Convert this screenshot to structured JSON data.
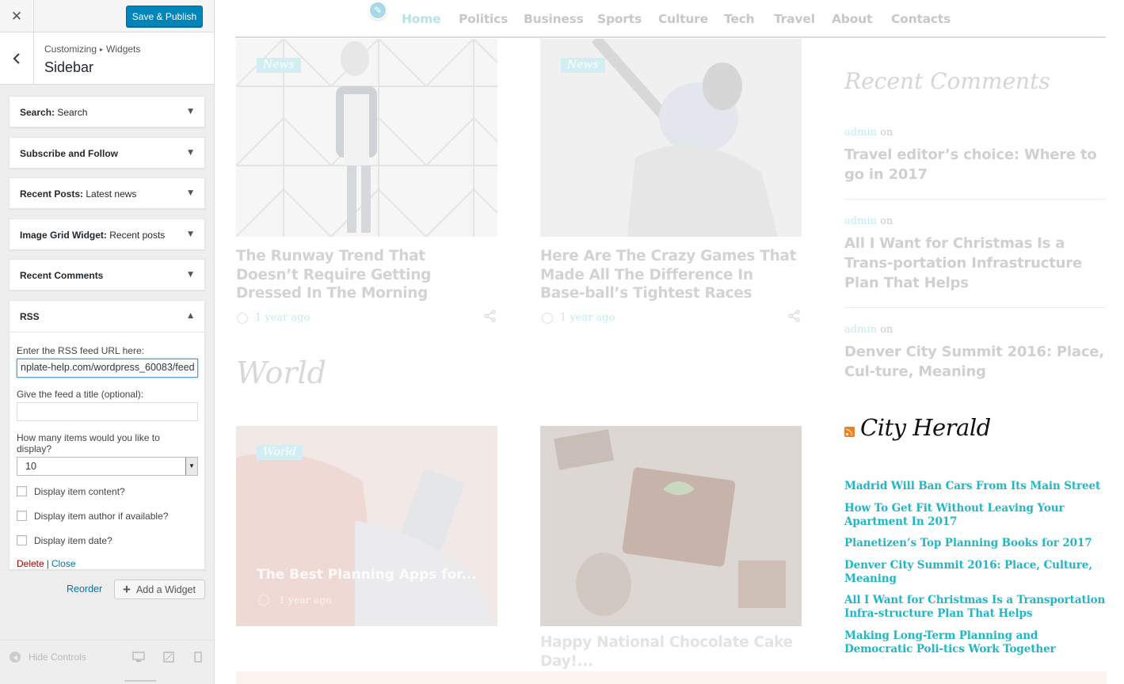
{
  "customizer": {
    "close_icon": "close-icon",
    "publish_label": "Save & Publish",
    "breadcrumb": {
      "parent": "Customizing",
      "child": "Widgets"
    },
    "section_title": "Sidebar",
    "widgets": [
      {
        "name": "Search:",
        "subtitle": " Search"
      },
      {
        "name": "Subscribe and Follow",
        "subtitle": ""
      },
      {
        "name": "Recent Posts:",
        "subtitle": " Latest news"
      },
      {
        "name": "Image Grid Widget:",
        "subtitle": " Recent posts"
      },
      {
        "name": "Recent Comments",
        "subtitle": ""
      }
    ],
    "rss_widget": {
      "name": "RSS",
      "url_label": "Enter the RSS feed URL here:",
      "url_value": "nplate-help.com/wordpress_60083/feed",
      "title_label": "Give the feed a title (optional):",
      "title_value": "",
      "items_label": "How many items would you like to display?",
      "items_value": "10",
      "check_content": "Display item content?",
      "check_author": "Display item author if available?",
      "check_date": "Display item date?",
      "delete_label": "Delete",
      "separator": "|",
      "close_label": "Close"
    },
    "reorder_label": "Reorder",
    "add_widget_label": "Add a Widget",
    "hide_controls_label": "Hide Controls"
  },
  "preview": {
    "nav": [
      "Home",
      "Politics",
      "Business",
      "Sports",
      "Culture",
      "Tech",
      "Travel",
      "About",
      "Contacts"
    ],
    "cards_top": [
      {
        "tag": "News",
        "title": "The Runway Trend That Doesn’t Require Getting Dressed In The Morning",
        "time": "1 year ago"
      },
      {
        "tag": "News",
        "title": "Here Are The Crazy Games That Made All The Difference In Base-ball’s Tightest Races",
        "time": "1 year ago"
      }
    ],
    "section_heading": "World",
    "cards_world": [
      {
        "tag": "World",
        "title": "The Best Planning Apps for...",
        "time": "1 year ago"
      },
      {
        "tag": "",
        "title": "Happy National Chocolate Cake Day!...",
        "time": ""
      }
    ],
    "recent_comments": {
      "heading": "Recent Comments",
      "items": [
        {
          "author": "admin",
          "on": " on",
          "title": "Travel editor’s choice: Where to go in 2017"
        },
        {
          "author": "admin",
          "on": " on",
          "title": "All I Want for Christmas Is a Trans-portation Infrastructure Plan That Helps"
        },
        {
          "author": "admin",
          "on": " on",
          "title": "Denver City Summit 2016: Place, Cul-ture, Meaning"
        }
      ]
    },
    "rss": {
      "title": "City Herald",
      "items": [
        "Madrid Will Ban Cars From Its Main Street",
        "How To Get Fit Without Leaving Your Apartment In 2017",
        "Planetizen’s Top Planning Books for 2017",
        "Denver City Summit 2016: Place, Culture, Meaning",
        "All I Want for Christmas Is a Transportation Infra-structure Plan That Helps",
        "Making Long-Term Planning and Democratic Poli-tics Work Together"
      ]
    }
  }
}
